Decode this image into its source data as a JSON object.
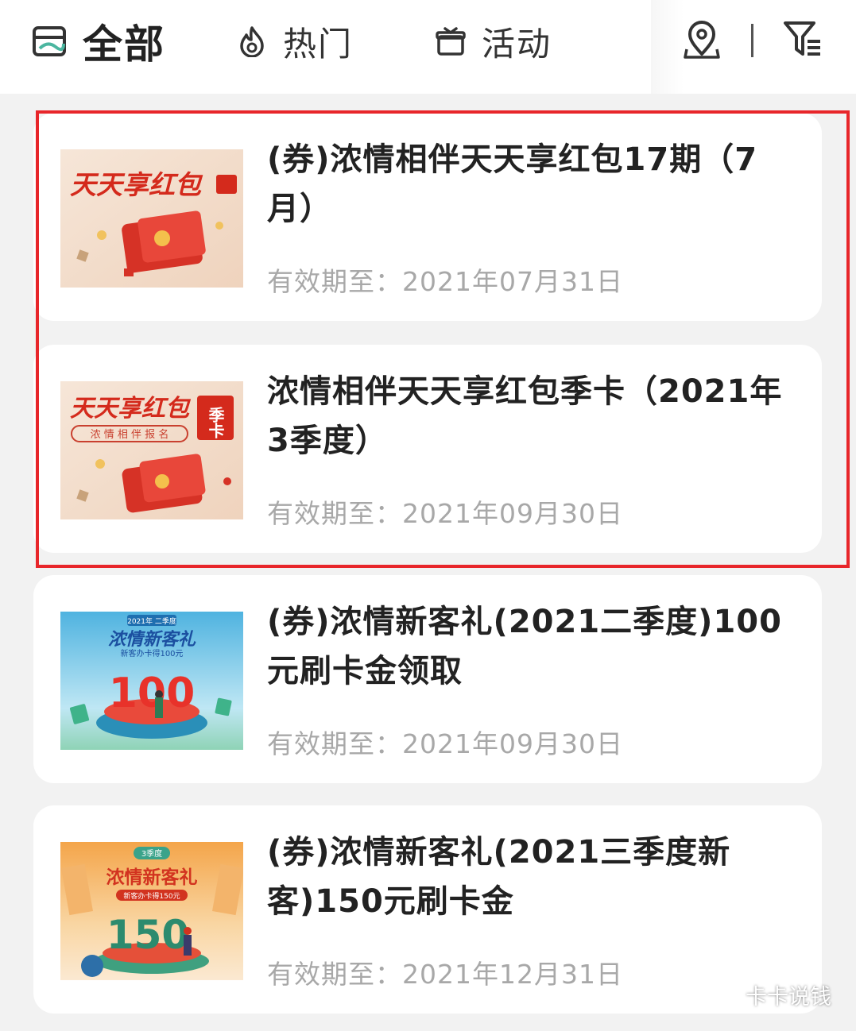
{
  "tabs": [
    {
      "label": "全部",
      "icon": "wallet-icon",
      "active": true
    },
    {
      "label": "热门",
      "icon": "flame-icon",
      "active": false
    },
    {
      "label": "活动",
      "icon": "gift-icon",
      "active": false
    }
  ],
  "toolbar": {
    "location_icon": "location-pin-icon",
    "filter_icon": "filter-icon"
  },
  "colors": {
    "highlight_border": "#e8262a",
    "title": "#222222",
    "date": "#a8a8a8"
  },
  "cards": [
    {
      "title": "(券)浓情相伴天天享红包17期（7月）",
      "date": "有效期至：2021年07月31日",
      "thumb": {
        "heading": "天天享红包",
        "theme": "red-packet"
      }
    },
    {
      "title": "浓情相伴天天享红包季卡（2021年3季度）",
      "date": "有效期至：2021年09月30日",
      "thumb": {
        "heading": "天天享红包",
        "badge": "季卡",
        "sub": "浓 情 相 伴 报 名",
        "theme": "red-packet"
      }
    },
    {
      "title": "(券)浓情新客礼(2021二季度)100元刷卡金领取",
      "date": "有效期至：2021年09月30日",
      "thumb": {
        "top": "2021年 二季度",
        "heading": "浓情新客礼",
        "sub": "新客办卡得100元",
        "number": "100",
        "theme": "teal"
      }
    },
    {
      "title": "(券)浓情新客礼(2021三季度新客)150元刷卡金",
      "date": "有效期至：2021年12月31日",
      "thumb": {
        "top": "3季度",
        "heading": "浓情新客礼",
        "sub": "新客办卡得150元",
        "number": "150",
        "theme": "orange"
      }
    }
  ],
  "watermark": "卡卡说钱"
}
